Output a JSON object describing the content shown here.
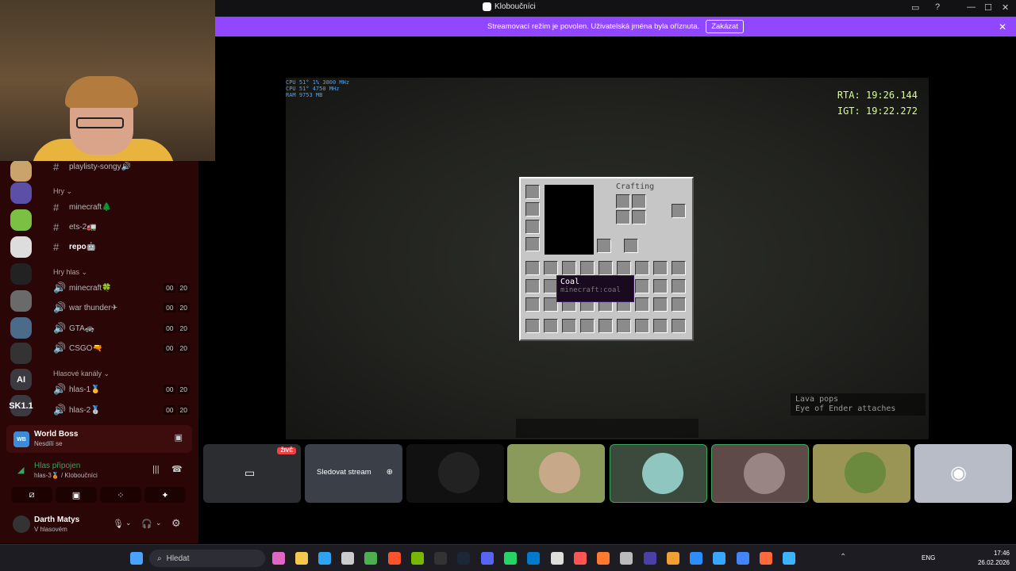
{
  "window": {
    "title": "Kloboučníci"
  },
  "banner": {
    "text": "Streamovací režim je povolen. Uživatelská jména byla oříznuta.",
    "button": "Zakázat"
  },
  "servers": [
    "AI",
    "SK1.1"
  ],
  "channels": {
    "top": {
      "name": "playlisty-songy🔊"
    },
    "cat_hry": "Hry",
    "hry": [
      {
        "name": "minecraft🌲"
      },
      {
        "name": "ets-2🚛"
      },
      {
        "name": "repo🤖"
      }
    ],
    "cat_hry_hlas": "Hry hlas",
    "hry_hlas": [
      {
        "name": "minecraft🍀",
        "a": "00",
        "b": "20"
      },
      {
        "name": "war thunder✈",
        "a": "00",
        "b": "20"
      },
      {
        "name": "GTA🚓",
        "a": "00",
        "b": "20"
      },
      {
        "name": "CSGO🔫",
        "a": "00",
        "b": "20"
      }
    ],
    "cat_hlasove": "Hlasové kanály",
    "hlasove": [
      {
        "name": "hlas-1🥇",
        "a": "00",
        "b": "20"
      },
      {
        "name": "hlas-2🥈",
        "a": "00",
        "b": "20"
      }
    ]
  },
  "world_boss": {
    "icon_text": "WB",
    "title": "World Boss",
    "sub": "Nesdílí se"
  },
  "voice": {
    "title": "Hlas připojen",
    "sub": "hlas-3🥉 / Kloboučníci"
  },
  "user": {
    "name": "Darth Matys",
    "status": "V hlasovém"
  },
  "game": {
    "hud_left": [
      "CPU 51° 1% 3800 MHz",
      "CPU 51° 4750 MHz",
      "RAM 9753 MB"
    ],
    "rta": "RTA: 19:26.144",
    "igt": "IGT: 19:22.272",
    "crafting": "Crafting",
    "tooltip_title": "Coal",
    "tooltip_id": "minecraft:coal",
    "chat": [
      "Lava pops",
      "Eye of Ender attaches"
    ]
  },
  "tiles": {
    "live": "ŽIVĚ",
    "watch": "Sledovat stream"
  },
  "taskbar": {
    "search": "Hledat",
    "lang": "ENG",
    "time": "17:46",
    "date": "26.02.2026"
  },
  "colors": {
    "banner": "#9147ff",
    "sidebar": "#2a0606",
    "accent_green": "#3ba55d"
  }
}
